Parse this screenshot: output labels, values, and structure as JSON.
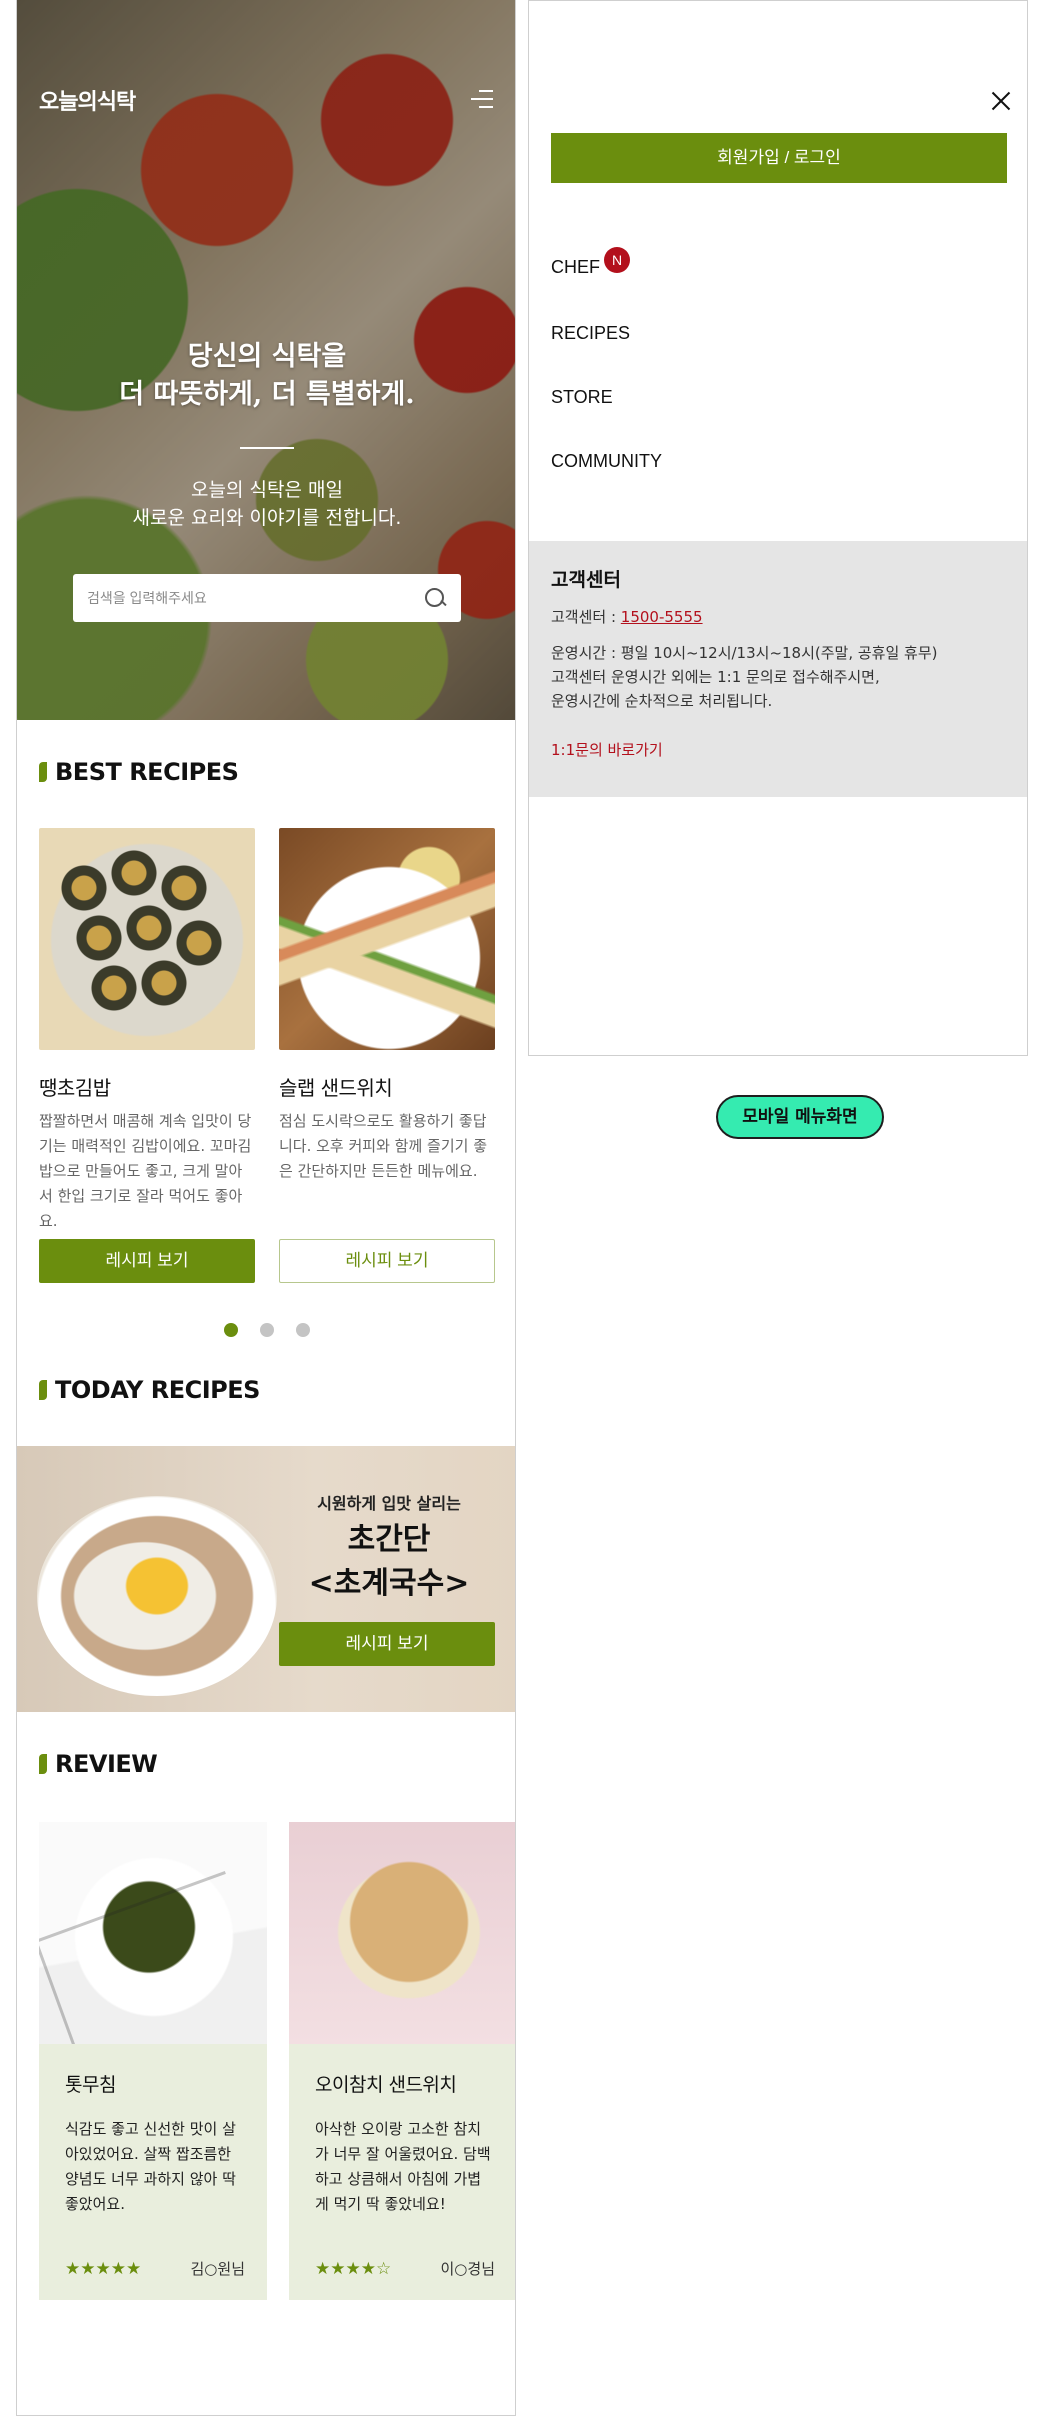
{
  "header": {
    "logo": "오늘의식탁"
  },
  "hero": {
    "title_line1": "당신의 식탁을",
    "title_line2": "더 따뜻하게, 더 특별하게.",
    "desc_line1": "오늘의 식탁은 매일",
    "desc_line2": "새로운 요리와 이야기를 전합니다."
  },
  "search": {
    "placeholder": "검색을 입력해주세요"
  },
  "best": {
    "title": "BEST RECIPES",
    "cards": [
      {
        "name": "땡초김밥",
        "desc": "짭짤하면서 매콤해 계속 입맛이 당기는 매력적인 김밥이에요. 꼬마김밥으로 만들어도 좋고, 크게 말아서 한입 크기로 잘라 먹어도 좋아요.",
        "button": "레시피 보기"
      },
      {
        "name": "슬랩 샌드위치",
        "desc": "점심 도시락으로도 활용하기 좋답니다. 오후 커피와 함께 즐기기 좋은 간단하지만 든든한 메뉴에요.",
        "button": "레시피 보기"
      }
    ],
    "dots": {
      "count": 3,
      "active": 1
    }
  },
  "today": {
    "title": "TODAY RECIPES",
    "subtitle": "시원하게 입맛 살리는",
    "name_line1": "초간단",
    "name_line2": "<초계국수>",
    "button": "레시피 보기"
  },
  "review": {
    "title": "REVIEW",
    "items": [
      {
        "name": "톳무침",
        "text": "식감도 좋고 신선한 맛이 살아있었어요. 살짝 짭조름한 양념도 너무 과하지 않아 딱 좋았어요.",
        "stars": "★★★★★",
        "rating": 5,
        "author": "김○원님"
      },
      {
        "name": "오이참치 샌드위치",
        "text": "아삭한 오이랑 고소한 참치가 너무 잘 어울렸어요. 담백하고 상큼해서 아침에 가볍게 먹기 딱 좋았네요!",
        "stars": "★★★★☆",
        "rating": 4,
        "author": "이○경님"
      }
    ]
  },
  "menu": {
    "login_label": "회원가입 / 로그인",
    "items": [
      {
        "label": "CHEF",
        "badge": "N"
      },
      {
        "label": "RECIPES"
      },
      {
        "label": "STORE"
      },
      {
        "label": "COMMUNITY"
      }
    ],
    "cs": {
      "title": "고객센터",
      "phone_label": "고객센터 : ",
      "phone": "1500-5555",
      "hours_line1": "운영시간 : 평일 10시~12시/13시~18시(주말, 공휴일 휴무)",
      "hours_line2": "고객센터 운영시간 외에는 1:1 문의로 접수해주시면,",
      "hours_line3": "운영시간에 순차적으로 처리됩니다.",
      "link": "1:1문의 바로가기"
    }
  },
  "caption": "모바일 메뉴화면",
  "colors": {
    "accent": "#6b8e0e",
    "badge": "#b3101c",
    "caption_pill": "#35ebb0",
    "review_bg": "#e9eedd"
  }
}
